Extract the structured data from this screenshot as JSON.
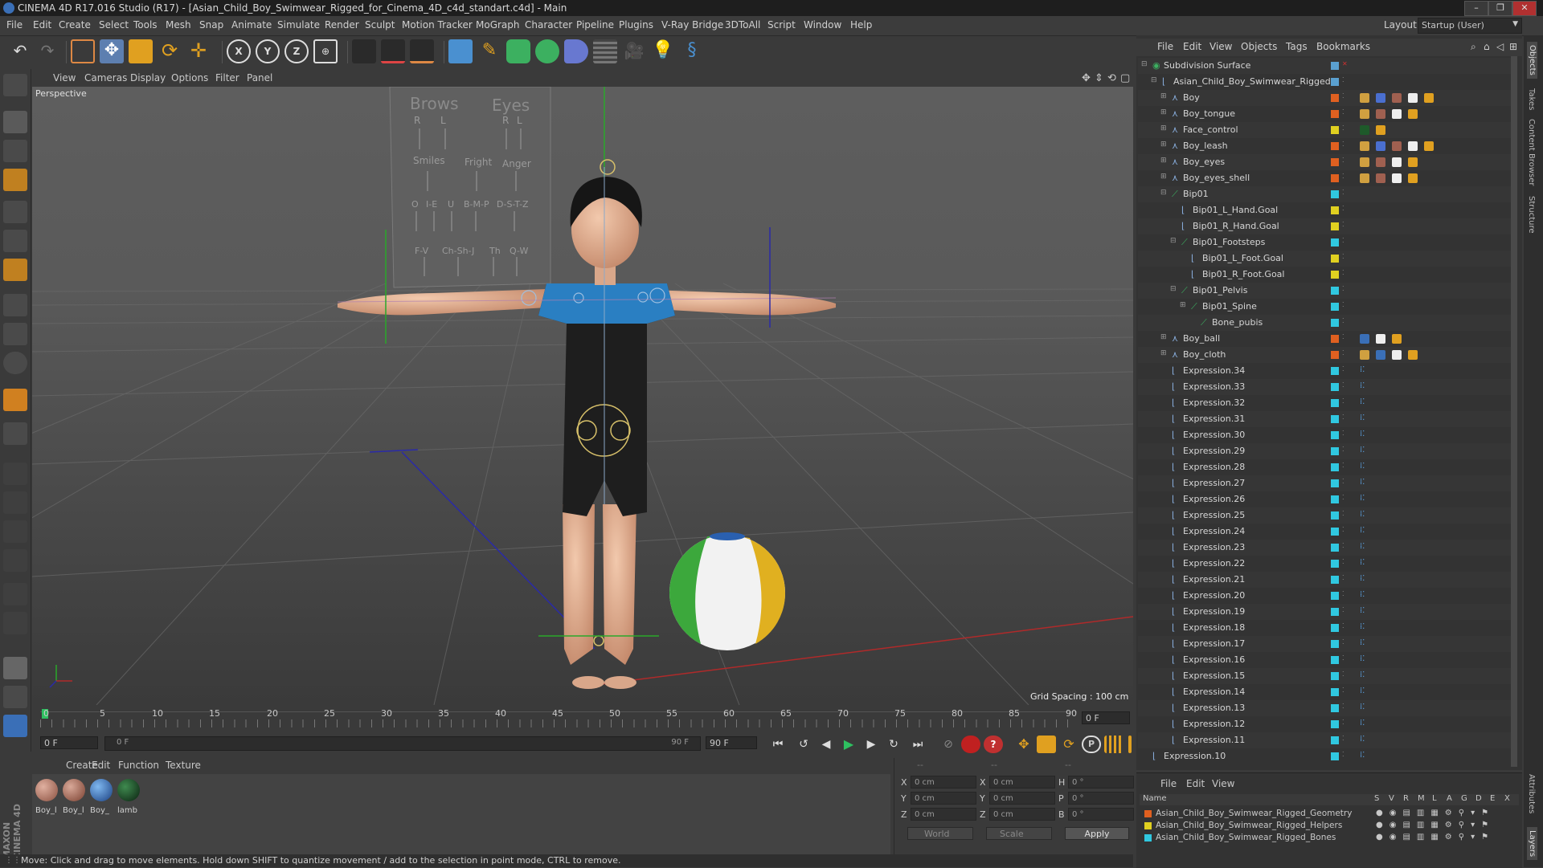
{
  "window": {
    "title": "CINEMA 4D R17.016 Studio (R17) - [Asian_Child_Boy_Swimwear_Rigged_for_Cinema_4D_c4d_standart.c4d] - Main",
    "buttons": [
      "–",
      "❐",
      "✕"
    ]
  },
  "menubar": {
    "items": [
      "File",
      "Edit",
      "Create",
      "Select",
      "Tools",
      "Mesh",
      "Snap",
      "Animate",
      "Simulate",
      "Render",
      "Sculpt",
      "Motion Tracker",
      "MoGraph",
      "Character",
      "Pipeline",
      "Plugins",
      "V-Ray Bridge",
      "3DToAll",
      "Script",
      "Window",
      "Help"
    ],
    "layout_label": "Layout:",
    "layout_value": "Startup (User)"
  },
  "viewport": {
    "menu": [
      "View",
      "Cameras",
      "Display",
      "Options",
      "Filter",
      "Panel"
    ],
    "label": "Perspective",
    "grid_spacing": "Grid Spacing : 100 cm",
    "board_labels": [
      "Brows",
      "Eyes",
      "R",
      "L",
      "R",
      "L",
      "Smiles",
      "Fright",
      "Anger",
      "O",
      "I-E",
      "U",
      "B-M-P",
      "D-S-T-Z",
      "F-V",
      "Ch-Sh-J",
      "Th",
      "Q-W"
    ]
  },
  "timeline": {
    "ticks": [
      "0",
      "5",
      "10",
      "15",
      "20",
      "25",
      "30",
      "35",
      "40",
      "45",
      "50",
      "55",
      "60",
      "65",
      "70",
      "75",
      "80",
      "85",
      "90"
    ],
    "current_frame": "0 F",
    "start_field": "0 F",
    "range_start": "0 F",
    "range_end": "90 F",
    "end_field": "90 F"
  },
  "materials": {
    "menu": [
      "Create",
      "Edit",
      "Function",
      "Texture"
    ],
    "items": [
      {
        "label": "Boy_l",
        "color": "#b07868"
      },
      {
        "label": "Boy_l",
        "color": "#a86c5c"
      },
      {
        "label": "Boy_",
        "color": "#3a6fb7"
      },
      {
        "label": "lamb",
        "color": "#1e5a2a"
      }
    ]
  },
  "coords": {
    "header": [
      "--",
      "--",
      "--"
    ],
    "rows": [
      {
        "a": "X",
        "av": "0 cm",
        "b": "X",
        "bv": "0 cm",
        "c": "H",
        "cv": "0 °"
      },
      {
        "a": "Y",
        "av": "0 cm",
        "b": "Y",
        "bv": "0 cm",
        "c": "P",
        "cv": "0 °"
      },
      {
        "a": "Z",
        "av": "0 cm",
        "b": "Z",
        "bv": "0 cm",
        "c": "B",
        "cv": "0 °"
      }
    ],
    "space": "World",
    "mode": "Scale",
    "apply": "Apply"
  },
  "status": "Move: Click and drag to move elements. Hold down SHIFT to quantize movement / add to the selection in point mode, CTRL to remove.",
  "object_manager": {
    "menu": [
      "File",
      "Edit",
      "View",
      "Objects",
      "Tags",
      "Bookmarks"
    ],
    "rows": [
      {
        "name": "Subdivision Surface",
        "color": "#5aa0d0"
      },
      {
        "name": "Asian_Child_Boy_Swimwear_Rigged",
        "color": "#5aa0d0"
      },
      {
        "name": "Boy",
        "color": "#e06020"
      },
      {
        "name": "Boy_tongue",
        "color": "#e06020"
      },
      {
        "name": "Face_control",
        "color": "#e0d020"
      },
      {
        "name": "Boy_leash",
        "color": "#e06020"
      },
      {
        "name": "Boy_eyes",
        "color": "#e06020"
      },
      {
        "name": "Boy_eyes_shell",
        "color": "#e06020"
      },
      {
        "name": "Bip01",
        "color": "#30c8e0"
      },
      {
        "name": "Bip01_L_Hand.Goal",
        "color": "#e0d020"
      },
      {
        "name": "Bip01_R_Hand.Goal",
        "color": "#e0d020"
      },
      {
        "name": "Bip01_Footsteps",
        "color": "#30c8e0"
      },
      {
        "name": "Bip01_L_Foot.Goal",
        "color": "#e0d020"
      },
      {
        "name": "Bip01_R_Foot.Goal",
        "color": "#e0d020"
      },
      {
        "name": "Bip01_Pelvis",
        "color": "#30c8e0"
      },
      {
        "name": "Bip01_Spine",
        "color": "#30c8e0"
      },
      {
        "name": "Bone_pubis",
        "color": "#30c8e0"
      },
      {
        "name": "Boy_ball",
        "color": "#e06020"
      },
      {
        "name": "Boy_cloth",
        "color": "#e06020"
      },
      {
        "name": "Expression.34",
        "color": "#30c8e0"
      },
      {
        "name": "Expression.33",
        "color": "#30c8e0"
      },
      {
        "name": "Expression.32",
        "color": "#30c8e0"
      },
      {
        "name": "Expression.31",
        "color": "#30c8e0"
      },
      {
        "name": "Expression.30",
        "color": "#30c8e0"
      },
      {
        "name": "Expression.29",
        "color": "#30c8e0"
      },
      {
        "name": "Expression.28",
        "color": "#30c8e0"
      },
      {
        "name": "Expression.27",
        "color": "#30c8e0"
      },
      {
        "name": "Expression.26",
        "color": "#30c8e0"
      },
      {
        "name": "Expression.25",
        "color": "#30c8e0"
      },
      {
        "name": "Expression.24",
        "color": "#30c8e0"
      },
      {
        "name": "Expression.23",
        "color": "#30c8e0"
      },
      {
        "name": "Expression.22",
        "color": "#30c8e0"
      },
      {
        "name": "Expression.21",
        "color": "#30c8e0"
      },
      {
        "name": "Expression.20",
        "color": "#30c8e0"
      },
      {
        "name": "Expression.19",
        "color": "#30c8e0"
      },
      {
        "name": "Expression.18",
        "color": "#30c8e0"
      },
      {
        "name": "Expression.17",
        "color": "#30c8e0"
      },
      {
        "name": "Expression.16",
        "color": "#30c8e0"
      },
      {
        "name": "Expression.15",
        "color": "#30c8e0"
      },
      {
        "name": "Expression.14",
        "color": "#30c8e0"
      },
      {
        "name": "Expression.13",
        "color": "#30c8e0"
      },
      {
        "name": "Expression.12",
        "color": "#30c8e0"
      },
      {
        "name": "Expression.11",
        "color": "#30c8e0"
      },
      {
        "name": "Expression.10",
        "color": "#30c8e0"
      }
    ]
  },
  "layer_manager": {
    "menu": [
      "File",
      "Edit",
      "View"
    ],
    "columns": [
      "Name",
      "S",
      "V",
      "R",
      "M",
      "L",
      "A",
      "G",
      "D",
      "E",
      "X"
    ],
    "layers": [
      {
        "name": "Asian_Child_Boy_Swimwear_Rigged_Geometry",
        "color": "#e06020"
      },
      {
        "name": "Asian_Child_Boy_Swimwear_Rigged_Helpers",
        "color": "#e0d020"
      },
      {
        "name": "Asian_Child_Boy_Swimwear_Rigged_Bones",
        "color": "#30c8e0"
      }
    ]
  },
  "right_tabs": [
    "Objects",
    "Takes",
    "Content Browser",
    "Structure",
    "Attributes",
    "Layers"
  ],
  "branding": "MAXON CINEMA 4D"
}
